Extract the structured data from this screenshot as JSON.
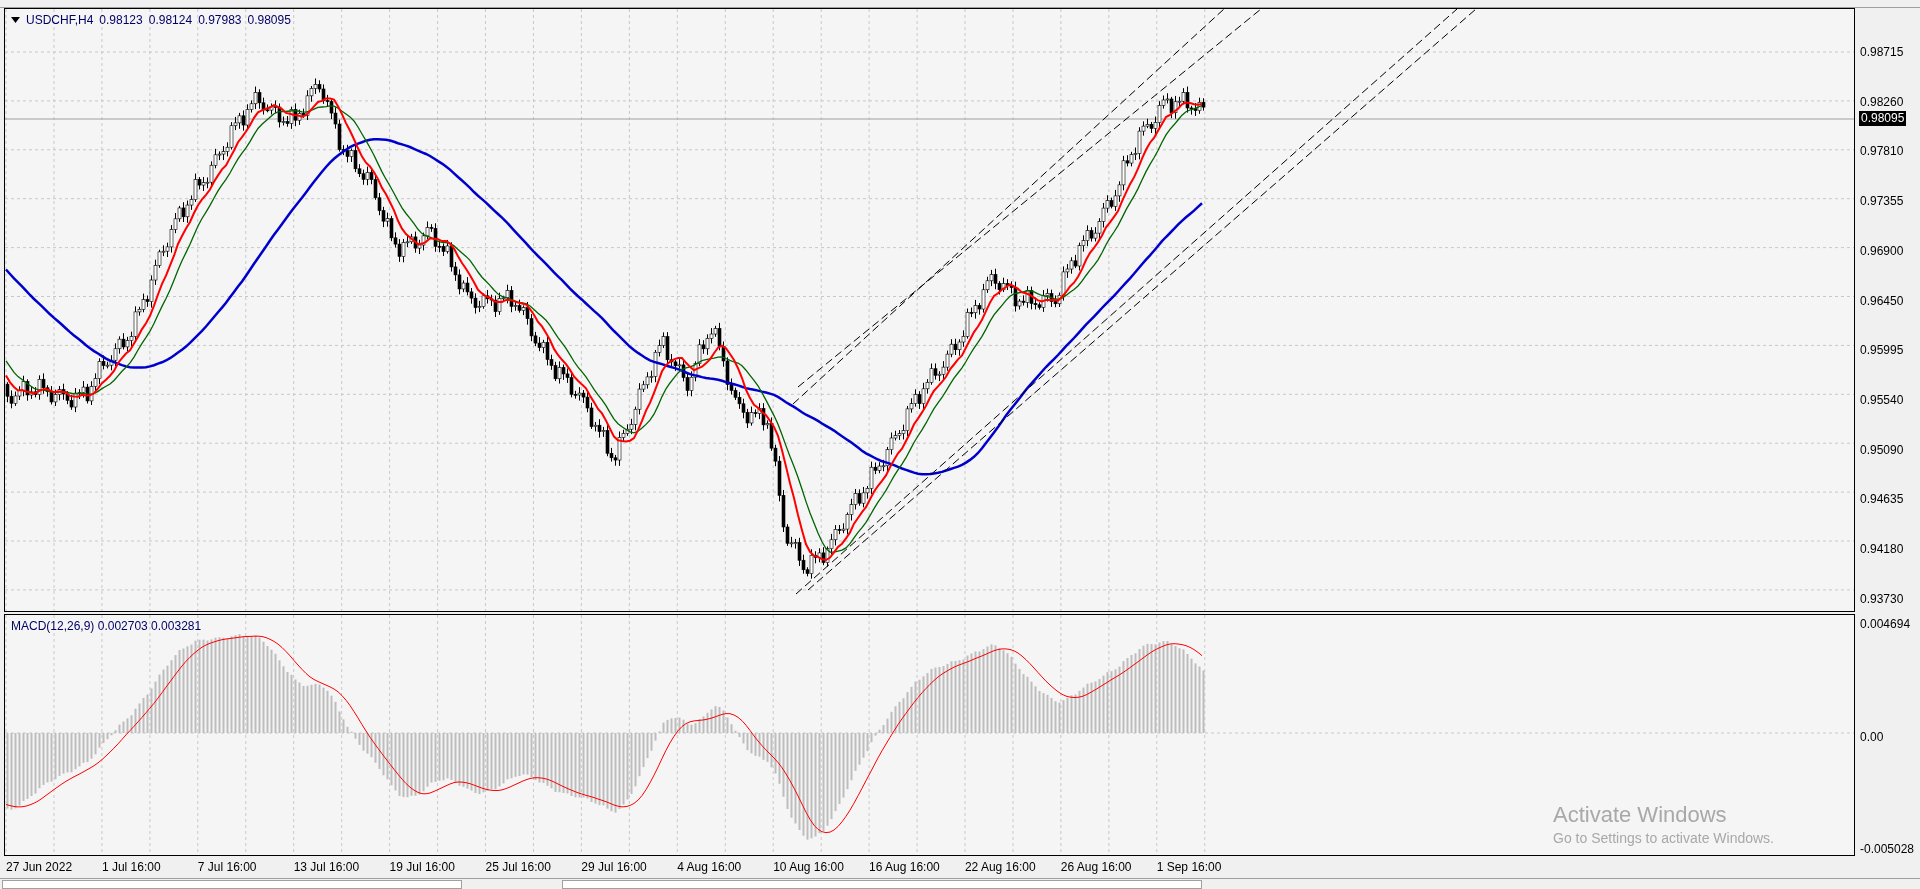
{
  "chart": {
    "title": "USDCHF,H4",
    "ohlc": [
      "0.98123",
      "0.98124",
      "0.97983",
      "0.98095"
    ],
    "price_axis": [
      "0.98715",
      "0.98260",
      "0.97810",
      "0.97355",
      "0.96900",
      "0.96450",
      "0.95995",
      "0.95540",
      "0.95090",
      "0.94635",
      "0.94180",
      "0.93730"
    ],
    "current_price": "0.98095"
  },
  "indicator": {
    "title": "MACD(12,26,9)",
    "values": [
      "0.002703",
      "0.003281"
    ],
    "axis": [
      "0.004694",
      "0.00",
      "-0.005028"
    ]
  },
  "time_axis": [
    "27 Jun 2022",
    "1 Jul 16:00",
    "7 Jul 16:00",
    "13 Jul 16:00",
    "19 Jul 16:00",
    "25 Jul 16:00",
    "29 Jul 16:00",
    "4 Aug 16:00",
    "10 Aug 16:00",
    "16 Aug 16:00",
    "22 Aug 16:00",
    "26 Aug 16:00",
    "1 Sep 16:00"
  ],
  "activation_notice": {
    "title": "Activate Windows",
    "text": "Go to Settings to activate Windows."
  }
}
